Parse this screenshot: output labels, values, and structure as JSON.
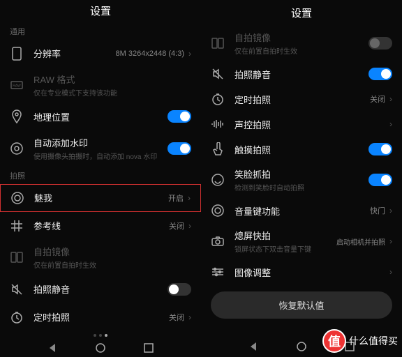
{
  "title": "设置",
  "sections": {
    "general": "通用",
    "photo": "拍照"
  },
  "left": {
    "resolution": {
      "label": "分辨率",
      "value": "8M 3264x2448 (4:3)"
    },
    "raw": {
      "label": "RAW 格式",
      "sub": "仅在专业模式下支持该功能"
    },
    "geo": {
      "label": "地理位置"
    },
    "watermark": {
      "label": "自动添加水印",
      "sub": "使用摄像头拍摄时，自动添加 nova 水印"
    },
    "meiwo": {
      "label": "魅我",
      "value": "开启"
    },
    "grid": {
      "label": "参考线",
      "value": "关闭"
    },
    "mirror": {
      "label": "自拍镜像",
      "sub": "仅在前置自拍时生效"
    },
    "mute": {
      "label": "拍照静音"
    },
    "timer": {
      "label": "定时拍照",
      "value": "关闭"
    }
  },
  "right": {
    "mirror": {
      "label": "自拍镜像",
      "sub": "仅在前置自拍时生效"
    },
    "mute": {
      "label": "拍照静音"
    },
    "timer": {
      "label": "定时拍照",
      "value": "关闭"
    },
    "voice": {
      "label": "声控拍照"
    },
    "touch": {
      "label": "触摸拍照"
    },
    "smile": {
      "label": "笑脸抓拍",
      "sub": "检测到笑脸时自动拍照"
    },
    "volkey": {
      "label": "音量键功能",
      "value": "快门"
    },
    "quickshot": {
      "label": "熄屏快拍",
      "sub": "锁屏状态下双击音量下键",
      "value": "启动相机并拍照"
    },
    "adjust": {
      "label": "图像调整"
    },
    "restore": "恢复默认值"
  },
  "badge": {
    "text": "什么值得买"
  }
}
